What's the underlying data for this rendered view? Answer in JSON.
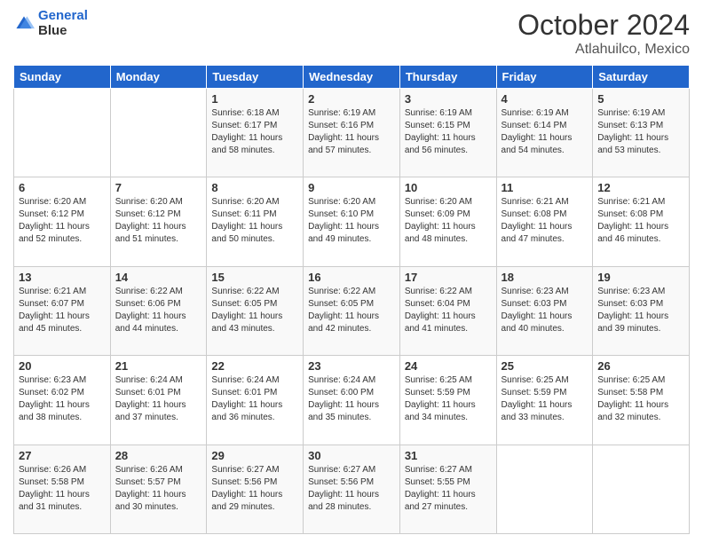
{
  "header": {
    "logo_line1": "General",
    "logo_line2": "Blue",
    "month_title": "October 2024",
    "subtitle": "Atlahuilco, Mexico"
  },
  "days_of_week": [
    "Sunday",
    "Monday",
    "Tuesday",
    "Wednesday",
    "Thursday",
    "Friday",
    "Saturday"
  ],
  "weeks": [
    [
      {
        "day": "",
        "info": ""
      },
      {
        "day": "",
        "info": ""
      },
      {
        "day": "1",
        "sunrise": "6:18 AM",
        "sunset": "6:17 PM",
        "daylight": "11 hours and 58 minutes."
      },
      {
        "day": "2",
        "sunrise": "6:19 AM",
        "sunset": "6:16 PM",
        "daylight": "11 hours and 57 minutes."
      },
      {
        "day": "3",
        "sunrise": "6:19 AM",
        "sunset": "6:15 PM",
        "daylight": "11 hours and 56 minutes."
      },
      {
        "day": "4",
        "sunrise": "6:19 AM",
        "sunset": "6:14 PM",
        "daylight": "11 hours and 54 minutes."
      },
      {
        "day": "5",
        "sunrise": "6:19 AM",
        "sunset": "6:13 PM",
        "daylight": "11 hours and 53 minutes."
      }
    ],
    [
      {
        "day": "6",
        "sunrise": "6:20 AM",
        "sunset": "6:12 PM",
        "daylight": "11 hours and 52 minutes."
      },
      {
        "day": "7",
        "sunrise": "6:20 AM",
        "sunset": "6:12 PM",
        "daylight": "11 hours and 51 minutes."
      },
      {
        "day": "8",
        "sunrise": "6:20 AM",
        "sunset": "6:11 PM",
        "daylight": "11 hours and 50 minutes."
      },
      {
        "day": "9",
        "sunrise": "6:20 AM",
        "sunset": "6:10 PM",
        "daylight": "11 hours and 49 minutes."
      },
      {
        "day": "10",
        "sunrise": "6:20 AM",
        "sunset": "6:09 PM",
        "daylight": "11 hours and 48 minutes."
      },
      {
        "day": "11",
        "sunrise": "6:21 AM",
        "sunset": "6:08 PM",
        "daylight": "11 hours and 47 minutes."
      },
      {
        "day": "12",
        "sunrise": "6:21 AM",
        "sunset": "6:08 PM",
        "daylight": "11 hours and 46 minutes."
      }
    ],
    [
      {
        "day": "13",
        "sunrise": "6:21 AM",
        "sunset": "6:07 PM",
        "daylight": "11 hours and 45 minutes."
      },
      {
        "day": "14",
        "sunrise": "6:22 AM",
        "sunset": "6:06 PM",
        "daylight": "11 hours and 44 minutes."
      },
      {
        "day": "15",
        "sunrise": "6:22 AM",
        "sunset": "6:05 PM",
        "daylight": "11 hours and 43 minutes."
      },
      {
        "day": "16",
        "sunrise": "6:22 AM",
        "sunset": "6:05 PM",
        "daylight": "11 hours and 42 minutes."
      },
      {
        "day": "17",
        "sunrise": "6:22 AM",
        "sunset": "6:04 PM",
        "daylight": "11 hours and 41 minutes."
      },
      {
        "day": "18",
        "sunrise": "6:23 AM",
        "sunset": "6:03 PM",
        "daylight": "11 hours and 40 minutes."
      },
      {
        "day": "19",
        "sunrise": "6:23 AM",
        "sunset": "6:03 PM",
        "daylight": "11 hours and 39 minutes."
      }
    ],
    [
      {
        "day": "20",
        "sunrise": "6:23 AM",
        "sunset": "6:02 PM",
        "daylight": "11 hours and 38 minutes."
      },
      {
        "day": "21",
        "sunrise": "6:24 AM",
        "sunset": "6:01 PM",
        "daylight": "11 hours and 37 minutes."
      },
      {
        "day": "22",
        "sunrise": "6:24 AM",
        "sunset": "6:01 PM",
        "daylight": "11 hours and 36 minutes."
      },
      {
        "day": "23",
        "sunrise": "6:24 AM",
        "sunset": "6:00 PM",
        "daylight": "11 hours and 35 minutes."
      },
      {
        "day": "24",
        "sunrise": "6:25 AM",
        "sunset": "5:59 PM",
        "daylight": "11 hours and 34 minutes."
      },
      {
        "day": "25",
        "sunrise": "6:25 AM",
        "sunset": "5:59 PM",
        "daylight": "11 hours and 33 minutes."
      },
      {
        "day": "26",
        "sunrise": "6:25 AM",
        "sunset": "5:58 PM",
        "daylight": "11 hours and 32 minutes."
      }
    ],
    [
      {
        "day": "27",
        "sunrise": "6:26 AM",
        "sunset": "5:58 PM",
        "daylight": "11 hours and 31 minutes."
      },
      {
        "day": "28",
        "sunrise": "6:26 AM",
        "sunset": "5:57 PM",
        "daylight": "11 hours and 30 minutes."
      },
      {
        "day": "29",
        "sunrise": "6:27 AM",
        "sunset": "5:56 PM",
        "daylight": "11 hours and 29 minutes."
      },
      {
        "day": "30",
        "sunrise": "6:27 AM",
        "sunset": "5:56 PM",
        "daylight": "11 hours and 28 minutes."
      },
      {
        "day": "31",
        "sunrise": "6:27 AM",
        "sunset": "5:55 PM",
        "daylight": "11 hours and 27 minutes."
      },
      {
        "day": "",
        "info": ""
      },
      {
        "day": "",
        "info": ""
      }
    ]
  ],
  "labels": {
    "sunrise_prefix": "Sunrise: ",
    "sunset_prefix": "Sunset: ",
    "daylight_prefix": "Daylight: "
  }
}
